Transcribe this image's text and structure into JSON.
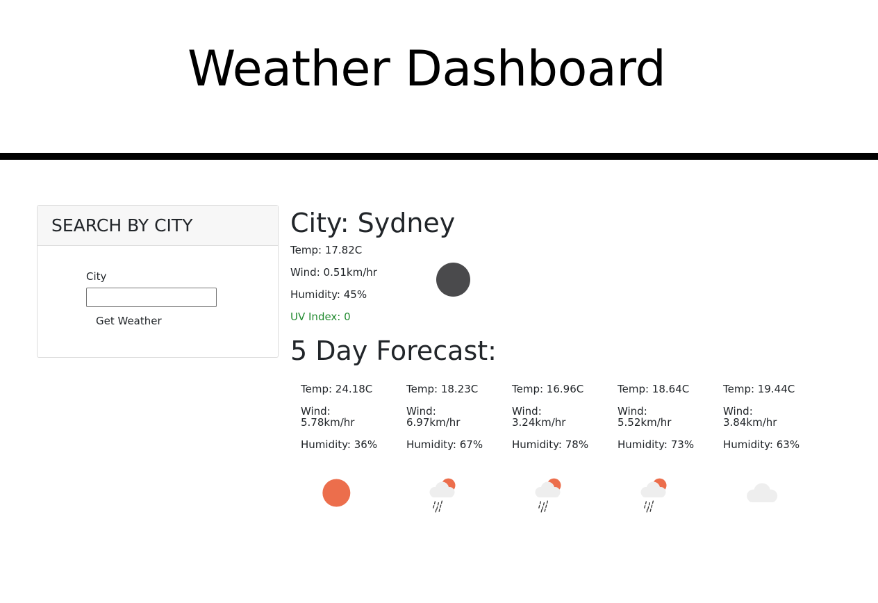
{
  "header": {
    "title": "Weather Dashboard"
  },
  "search": {
    "heading": "SEARCH BY CITY",
    "city_label": "City",
    "city_value": "",
    "button_label": "Get Weather"
  },
  "current": {
    "city": "City: Sydney",
    "temp": "Temp: 17.82C",
    "wind": "Wind: 0.51km/hr",
    "humidity": "Humidity: 45%",
    "uv": "UV Index: 0",
    "uv_color": "#218a2f",
    "icon": "dark-circle-icon"
  },
  "forecast": {
    "heading": "5 Day Forecast:",
    "days": [
      {
        "temp": "Temp: 24.18C",
        "wind_label": "Wind:",
        "wind_value": "5.78km/hr",
        "humidity": "Humidity: 36%",
        "icon": "sun-icon"
      },
      {
        "temp": "Temp: 18.23C",
        "wind_label": "Wind:",
        "wind_value": "6.97km/hr",
        "humidity": "Humidity: 67%",
        "icon": "rain-sun-icon"
      },
      {
        "temp": "Temp: 16.96C",
        "wind_label": "Wind:",
        "wind_value": "3.24km/hr",
        "humidity": "Humidity: 78%",
        "icon": "rain-sun-icon"
      },
      {
        "temp": "Temp: 18.64C",
        "wind_label": "Wind:",
        "wind_value": "5.52km/hr",
        "humidity": "Humidity: 73%",
        "icon": "rain-sun-icon"
      },
      {
        "temp": "Temp: 19.44C",
        "wind_label": "Wind:",
        "wind_value": "3.84km/hr",
        "humidity": "Humidity: 63%",
        "icon": "cloud-icon"
      }
    ]
  },
  "colors": {
    "sun": "#ec6e4c",
    "cloud": "#eeeeee",
    "rain": "#333333",
    "dark_icon": "#4a4a4c"
  }
}
